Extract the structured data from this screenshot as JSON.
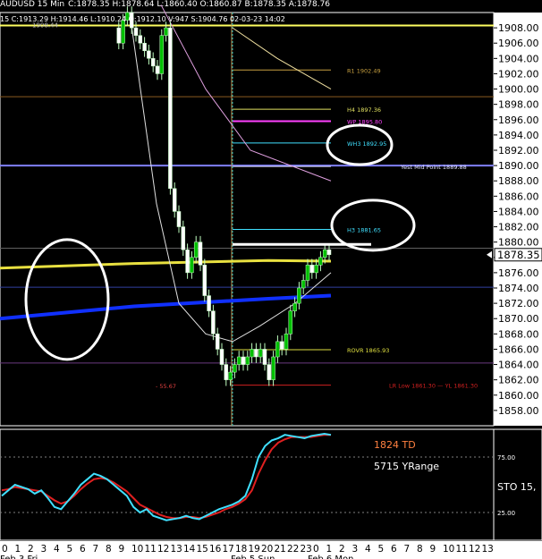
{
  "header": {
    "symbol": "AUDUSD 15 Min",
    "ohlc": "C:1878.35 H:1878.64 L:1860.40 O:1860.87 B:1878.35 A:1878.76",
    "stats": "15 C:1913.29 H:1914.46 L:1910.24 O:1912.10 V:947 S:1904.76 02-03-23 14:02",
    "icons": [
      "toolbar-icon-1",
      "toolbar-icon-2",
      "toolbar-icon-3",
      "toolbar-icon-4",
      "toolbar-icon-5",
      "toolbar-icon-6",
      "toolbar-icon-7"
    ]
  },
  "chart_data": {
    "type": "candlestick",
    "price_axis": {
      "range": [
        1856,
        1910
      ],
      "ticks": [
        1858,
        1860,
        1862,
        1864,
        1866,
        1868,
        1870,
        1872,
        1874,
        1876,
        1878,
        1880,
        1882,
        1884,
        1886,
        1888,
        1890,
        1892,
        1894,
        1896,
        1898,
        1900,
        1902,
        1904,
        1906,
        1908
      ],
      "current_price": 1878.35,
      "current_label": "1878.35"
    },
    "levels": [
      {
        "label": "R1 1902.49",
        "price": 1902.49,
        "color": "#c8a040"
      },
      {
        "label": "H4 1897.36",
        "price": 1897.36,
        "color": "#e0e060"
      },
      {
        "label": "WP 1895.80",
        "price": 1895.8,
        "color": "#ff40ff"
      },
      {
        "label": "WH3 1892.95",
        "price": 1892.95,
        "color": "#40e0ff"
      },
      {
        "label": "Yest Mid Point 1889.88",
        "price": 1889.88,
        "color": "#e0e0ff"
      },
      {
        "label": "H3 1881.65",
        "price": 1881.65,
        "color": "#40e0ff"
      },
      {
        "label": "ROVR 1865.93",
        "price": 1865.93,
        "color": "#e0e040"
      },
      {
        "label": "LR Low 1861.30 — YL 1861.30",
        "price": 1861.3,
        "color": "#d02020"
      }
    ],
    "annotations": [
      {
        "text": "1908.44",
        "price": 1908.44
      },
      {
        "text": "- 55.67",
        "price": 1861.0
      }
    ],
    "close_series": [
      1908,
      1906,
      1909,
      1910,
      1908,
      1907,
      1906,
      1905,
      1904,
      1903,
      1902,
      1907,
      1908,
      1887,
      1884,
      1882,
      1879,
      1876,
      1878,
      1880,
      1877,
      1873,
      1871,
      1868,
      1866,
      1864,
      1862,
      1863,
      1864,
      1865,
      1864,
      1865,
      1866,
      1865,
      1866,
      1864,
      1862,
      1865,
      1867,
      1866,
      1868,
      1871,
      1872,
      1874,
      1875,
      1877,
      1876,
      1877,
      1878,
      1879,
      1878.35
    ],
    "stochastic": {
      "label": "STO 15,",
      "levels": [
        25,
        75
      ],
      "level_labels": [
        "25.00",
        "75.00"
      ],
      "k": [
        40,
        45,
        50,
        48,
        46,
        42,
        45,
        38,
        30,
        28,
        35,
        42,
        50,
        55,
        60,
        58,
        55,
        50,
        45,
        40,
        30,
        25,
        28,
        22,
        20,
        18,
        19,
        20,
        22,
        20,
        19,
        22,
        25,
        28,
        30,
        32,
        35,
        40,
        55,
        75,
        85,
        90,
        92,
        95,
        94,
        93,
        92,
        94,
        95,
        96,
        95
      ],
      "d": [
        45,
        46,
        48,
        47,
        46,
        45,
        44,
        40,
        36,
        33,
        35,
        40,
        46,
        51,
        55,
        56,
        55,
        52,
        48,
        44,
        38,
        32,
        29,
        26,
        23,
        21,
        20,
        20,
        21,
        21,
        20,
        21,
        23,
        25,
        28,
        30,
        33,
        37,
        45,
        60,
        72,
        82,
        88,
        91,
        93,
        93,
        93,
        93,
        94,
        95,
        95
      ]
    },
    "info_text": [
      "1824 TD",
      "5715 YRange"
    ],
    "x_ticks": [
      "0",
      "1",
      "2",
      "3",
      "4",
      "5",
      "6",
      "7",
      "8",
      "9",
      "10",
      "11",
      "12",
      "13",
      "14",
      "15",
      "16",
      "17",
      "18",
      "19",
      "20",
      "21",
      "22",
      "23",
      "0",
      "1",
      "2",
      "3",
      "4",
      "5",
      "6",
      "7",
      "8",
      "9",
      "10",
      "11",
      "12",
      "13"
    ],
    "date_labels": [
      "Feb 3 Fri",
      "Feb 5 Sun",
      "Feb 6 Mon"
    ]
  }
}
